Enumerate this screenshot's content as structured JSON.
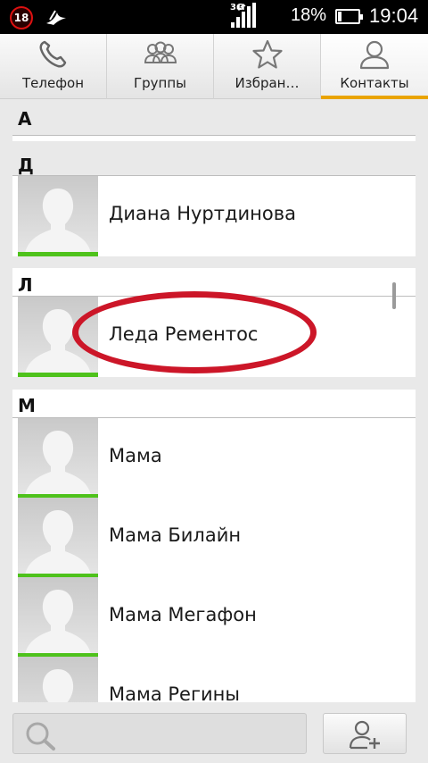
{
  "status_bar": {
    "badge": "18",
    "network": "3G",
    "battery_percent": "18%",
    "battery_level": 0.18,
    "time": "19:04"
  },
  "tabs": [
    {
      "label": "Телефон",
      "icon": "phone-icon",
      "active": false
    },
    {
      "label": "Группы",
      "icon": "groups-icon",
      "active": false
    },
    {
      "label": "Избран…",
      "icon": "star-icon",
      "active": false
    },
    {
      "label": "Контакты",
      "icon": "contact-icon",
      "active": true
    }
  ],
  "sections": [
    {
      "letter": "А",
      "contacts": []
    },
    {
      "letter": "Д",
      "contacts": [
        {
          "name": "Диана Нуртдинова"
        }
      ]
    },
    {
      "letter": "Л",
      "contacts": [
        {
          "name": "Леда Рементос",
          "highlighted": true
        }
      ]
    },
    {
      "letter": "М",
      "contacts": [
        {
          "name": "Мама"
        },
        {
          "name": "Мама Билайн"
        },
        {
          "name": "Мама Мегафон"
        },
        {
          "name": "Мама Регины"
        }
      ]
    }
  ],
  "bottom_bar": {
    "search_value": "",
    "search_icon": "search-icon",
    "add_icon": "add-contact-icon"
  },
  "colors": {
    "active_tab_accent": "#e9a400",
    "avatar_bar": "#4ec21b",
    "highlight": "#cc1628",
    "badge_ring": "#dd1111"
  }
}
